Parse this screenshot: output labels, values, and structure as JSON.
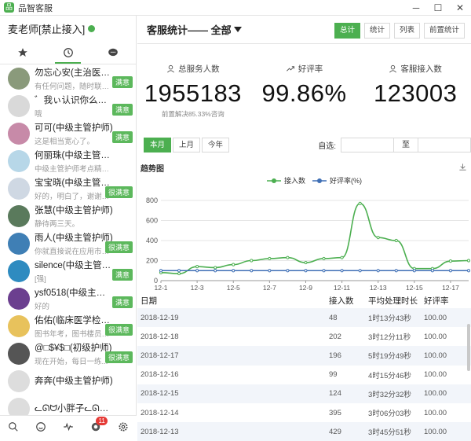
{
  "window": {
    "title": "品智客服",
    "minimize": "─",
    "maximize": "☐",
    "close": "✕"
  },
  "agent": {
    "name": "麦老师[禁止接入]",
    "status_color": "#4caf50"
  },
  "side_tabs": [
    {
      "icon": "star-icon"
    },
    {
      "icon": "clock-icon"
    },
    {
      "icon": "chat-bubble-icon"
    }
  ],
  "conversations": [
    {
      "name": "勿忘心安(主治医师（...",
      "msg": "有任何问题，随时联系...",
      "badge": "满意",
      "color": "#8a9a7b"
    },
    {
      "name": "゛我ぃ认识你么づ(中...",
      "msg": "哦",
      "badge": "满意",
      "color": "#d9d9d9"
    },
    {
      "name": "可可(中级主管护师)",
      "msg": "这是相当宽心了。",
      "badge": "满意",
      "color": "#c78aa8"
    },
    {
      "name": "何丽珠(中级主管护师)",
      "msg": "中级主管护师考点精编...",
      "badge": "",
      "color": "#b7d7e8"
    },
    {
      "name": "宝宝晓(中级主管护师)",
      "msg": "好的，明白了，谢谢老...",
      "badge": "很满意",
      "color": "#cfd8e3"
    },
    {
      "name": "张慧(中级主管护师)",
      "msg": "静待两三天。",
      "badge": "",
      "color": "#5a7a5c"
    },
    {
      "name": "雨人(中级主管护师)",
      "msg": "你就直接说在应用市场...",
      "badge": "很满意",
      "color": "#3f7fb5"
    },
    {
      "name": "silence(中级主管护师)",
      "msg": "[强]",
      "badge": "满意",
      "color": "#2e8bc0"
    },
    {
      "name": "ysf0518(中级主管护师)",
      "msg": "好的",
      "badge": "满意",
      "color": "#6b3f8f"
    },
    {
      "name": "佑佑(临床医学检验技...",
      "msg": "图书年考，图书楼员方...",
      "badge": "很满意",
      "color": "#e8c25c"
    },
    {
      "name": "@□$¥$□(初级护师)",
      "msg": "现在开始，每日一练...",
      "badge": "很满意",
      "color": "#555555"
    },
    {
      "name": "奔奔(中级主管护师)",
      "msg": "",
      "badge": "",
      "color": "#dddddd"
    },
    {
      "name": "ᓚᘏᗢ小胖子ᓚᘏᗢ(初级护师)",
      "msg": "",
      "badge": "",
      "color": "#dddddd"
    }
  ],
  "bottom_bar": {
    "notification_count": "11"
  },
  "header": {
    "title": "客服统计—— 全部",
    "buttons": [
      "总计",
      "统计",
      "列表",
      "前置统计"
    ]
  },
  "stats": [
    {
      "label": "总服务人数",
      "value": "1955183",
      "sub": "前置解决85.33%咨询"
    },
    {
      "label": "好评率",
      "value": "99.86%",
      "sub": ""
    },
    {
      "label": "客服接入数",
      "value": "123003",
      "sub": ""
    }
  ],
  "period": {
    "buttons": [
      "本月",
      "上月",
      "今年"
    ],
    "custom_label": "自选:",
    "to_label": "至"
  },
  "chart_data": {
    "type": "line",
    "title": "趋势图",
    "x": [
      "12-1",
      "12-2",
      "12-3",
      "12-4",
      "12-5",
      "12-6",
      "12-7",
      "12-8",
      "12-9",
      "12-10",
      "12-11",
      "12-12",
      "12-13",
      "12-14",
      "12-15",
      "12-16",
      "12-17",
      "12-18"
    ],
    "x_ticks": [
      "12-1",
      "12-3",
      "12-5",
      "12-7",
      "12-9",
      "12-11",
      "12-13",
      "12-15",
      "12-17"
    ],
    "series": [
      {
        "name": "接入数",
        "color": "#4caf50",
        "values": [
          80,
          70,
          140,
          130,
          160,
          200,
          220,
          230,
          180,
          220,
          230,
          770,
          430,
          400,
          120,
          120,
          195,
          200
        ]
      },
      {
        "name": "好评率(%)",
        "color": "#3f6fb5",
        "values": [
          100,
          100,
          100,
          100,
          100,
          100,
          100,
          100,
          100,
          100,
          100,
          100,
          100,
          100,
          100,
          100,
          100,
          100
        ]
      }
    ],
    "y_ticks": [
      0,
      200,
      400,
      600,
      800
    ],
    "ylim": [
      0,
      800
    ],
    "grid": true,
    "legend": "top"
  },
  "table": {
    "headers": [
      "日期",
      "接入数",
      "平均处理时长",
      "好评率"
    ],
    "rows": [
      [
        "2018-12-19",
        "48",
        "1时13分43秒",
        "100.00"
      ],
      [
        "2018-12-18",
        "202",
        "3时12分11秒",
        "100.00"
      ],
      [
        "2018-12-17",
        "196",
        "5时19分49秒",
        "100.00"
      ],
      [
        "2018-12-16",
        "99",
        "4时15分46秒",
        "100.00"
      ],
      [
        "2018-12-15",
        "124",
        "3时32分32秒",
        "100.00"
      ],
      [
        "2018-12-14",
        "395",
        "3时06分03秒",
        "100.00"
      ],
      [
        "2018-12-13",
        "429",
        "3时45分51秒",
        "100.00"
      ]
    ]
  }
}
